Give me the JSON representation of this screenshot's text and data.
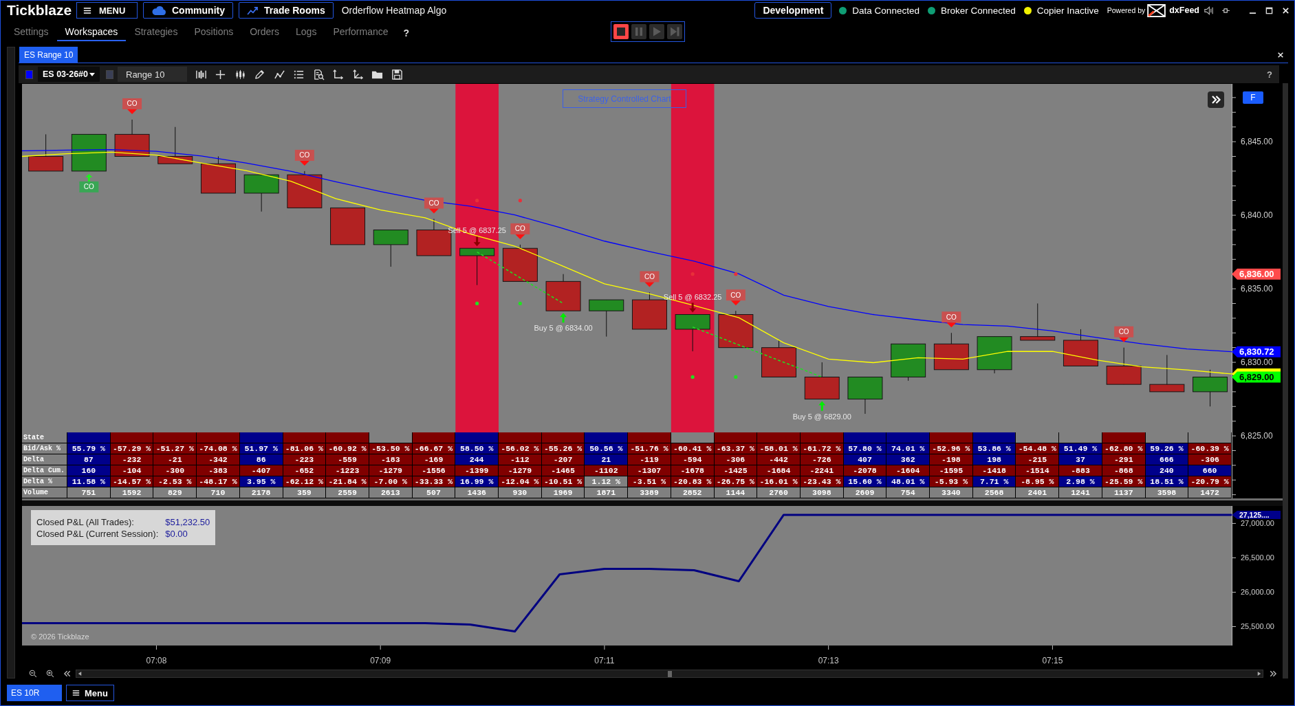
{
  "app_bar": {
    "logo": "Tickblaze",
    "menu_button": "MENU",
    "links": [
      "Community",
      "Trade Rooms"
    ],
    "title": "Orderflow Heatmap Algo",
    "environment_button": "Development",
    "statuses": [
      {
        "label": "Data Connected",
        "color": "#0f9d74"
      },
      {
        "label": "Broker Connected",
        "color": "#0f9d74"
      },
      {
        "label": "Copier Inactive",
        "color": "#f2f200"
      }
    ],
    "powered_by": "Powered by",
    "provider": "dxFeed"
  },
  "nav_tabs": [
    {
      "label": "Settings",
      "selected": false
    },
    {
      "label": "Workspaces",
      "selected": true
    },
    {
      "label": "Strategies",
      "selected": false
    },
    {
      "label": "Positions",
      "selected": false
    },
    {
      "label": "Orders",
      "selected": false
    },
    {
      "label": "Logs",
      "selected": false
    },
    {
      "label": "Performance",
      "selected": false
    }
  ],
  "help": "?",
  "playback_controls": [
    {
      "kind": "stop",
      "active": true
    },
    {
      "kind": "pause",
      "active": false
    },
    {
      "kind": "play",
      "active": false
    },
    {
      "kind": "step",
      "active": false
    }
  ],
  "document_tabs": [
    {
      "label": "ES Range 10",
      "selected": true
    }
  ],
  "chart_toolbar": {
    "instrument": {
      "label": "ES 03-26#0",
      "color": "#0000ff"
    },
    "bar_type": {
      "label": "Range 10",
      "color": "#3a3f55"
    },
    "help": "?"
  },
  "price_chart": {
    "strategy_button": "Strategy Controlled Chart",
    "scale_button": "F",
    "chart_data": {
      "type": "line",
      "categories": [
        null,
        null,
        null,
        null,
        null,
        null,
        null,
        null,
        null,
        null,
        null,
        null,
        null,
        null,
        null,
        null,
        null,
        null,
        null,
        null,
        null,
        null,
        null,
        null,
        null,
        null,
        null,
        null
      ],
      "ylim": [
        6820.75,
        6848.93
      ],
      "yticks": [
        {
          "value": 6825,
          "label": "6,825.00"
        },
        {
          "value": 6830,
          "label": "6,830.00"
        },
        {
          "value": 6835,
          "label": "6,835.00"
        },
        {
          "value": 6840,
          "label": "6,840.00"
        },
        {
          "value": 6845,
          "label": "6,845.00"
        }
      ],
      "series": [
        {
          "color": "#ffff00",
          "values": [
            6844.0,
            6844.18,
            6844.29,
            6844.09,
            6843.55,
            6843.04,
            6842.31,
            6841.13,
            6840.36,
            6839.82,
            6838.73,
            6837.9,
            6836.63,
            6835.34,
            6834.66,
            6833.86,
            6833.03,
            6831.33,
            6830.22,
            6829.98,
            6830.31,
            6830.22,
            6830.74,
            6830.74,
            6830.15,
            6829.69,
            6829.48,
            6829.21
          ]
        },
        {
          "color": "#0000ff",
          "values": [
            6844.38,
            6844.43,
            6844.46,
            6844.34,
            6844.03,
            6843.55,
            6842.99,
            6842.28,
            6841.61,
            6841.01,
            6840.62,
            6840.02,
            6839.17,
            6838.24,
            6837.53,
            6836.88,
            6836.01,
            6834.57,
            6833.79,
            6833.25,
            6832.89,
            6832.57,
            6832.46,
            6832.14,
            6831.68,
            6831.26,
            6830.91,
            6830.72
          ]
        }
      ]
    },
    "price_tags": [
      {
        "label": "6,836.00",
        "color": "#ff4b4b"
      },
      {
        "label": "6,830.72",
        "color": "#0000ff"
      },
      {
        "color": "#ffff00"
      },
      {
        "label": "6,829.00",
        "color": "#00ff00"
      }
    ],
    "bars": [
      {
        "highlighted": false
      },
      {
        "highlighted": false,
        "signal": {
          "kind": "up",
          "label": "CO"
        }
      },
      {
        "highlighted": false,
        "signal": {
          "kind": "down",
          "label": "CO"
        }
      },
      {
        "highlighted": false
      },
      {
        "highlighted": false
      },
      {
        "highlighted": false
      },
      {
        "highlighted": false,
        "signal": {
          "kind": "down",
          "label": "CO"
        }
      },
      {
        "highlighted": false
      },
      {
        "highlighted": false
      },
      {
        "highlighted": false,
        "signal": {
          "kind": "down",
          "label": "CO"
        }
      },
      {
        "highlighted": true,
        "trade": {
          "kind": "sell",
          "label": "Sell 5 @ 6837.25"
        }
      },
      {
        "highlighted": false,
        "signal": {
          "kind": "down",
          "label": "CO"
        }
      },
      {
        "highlighted": false,
        "trade": {
          "kind": "buy",
          "label": "Buy 5 @ 6834.00"
        }
      },
      {
        "highlighted": false
      },
      {
        "highlighted": false,
        "signal": {
          "kind": "down",
          "label": "CO"
        }
      },
      {
        "highlighted": true,
        "trade": {
          "kind": "sell",
          "label": "Sell 5 @ 6832.25"
        }
      },
      {
        "highlighted": false,
        "signal": {
          "kind": "down",
          "label": "CO"
        }
      },
      {
        "highlighted": false
      },
      {
        "highlighted": false,
        "trade": {
          "kind": "buy",
          "label": "Buy 5 @ 6829.00"
        }
      },
      {
        "highlighted": false
      },
      {
        "highlighted": false
      },
      {
        "highlighted": false,
        "signal": {
          "kind": "down",
          "label": "CO"
        }
      },
      {
        "highlighted": false
      },
      {
        "highlighted": false
      },
      {
        "highlighted": false
      },
      {
        "highlighted": false,
        "signal": {
          "kind": "down",
          "label": "CO"
        }
      },
      {
        "highlighted": false
      },
      {
        "highlighted": false
      }
    ]
  },
  "data_table": {
    "rows": [
      {
        "label": "State",
        "cells": [
          {
            "color": "#00008b"
          },
          {
            "color": "#800000"
          },
          {
            "color": "#800000"
          },
          {
            "color": "#800000"
          },
          {
            "color": "#00008b"
          },
          {
            "color": "#800000"
          },
          {
            "color": "#800000"
          },
          {
            "color": "#808080"
          },
          {
            "color": "#800000"
          },
          {
            "color": "#00008b"
          },
          {
            "color": "#800000"
          },
          {
            "color": "#800000"
          },
          {
            "color": "#00008b"
          },
          {
            "color": "#800000"
          },
          {
            "color": "#808080"
          },
          {
            "color": "#800000"
          },
          {
            "color": "#800000"
          },
          {
            "color": "#800000"
          },
          {
            "color": "#00008b"
          },
          {
            "color": "#00008b"
          },
          {
            "color": "#800000"
          },
          {
            "color": "#00008b"
          },
          {
            "color": "#808080"
          },
          {
            "color": "#808080"
          },
          {
            "color": "#800000"
          },
          {
            "color": "#808080"
          },
          {
            "color": "#808080"
          }
        ]
      },
      {
        "label": "Bid/Ask %",
        "cells": [
          {
            "text": "55.79 %",
            "color": "#00008b"
          },
          {
            "text": "-57.29 %",
            "color": "#800000"
          },
          {
            "text": "-51.27 %",
            "color": "#800000"
          },
          {
            "text": "-74.08 %",
            "color": "#800000"
          },
          {
            "text": "51.97 %",
            "color": "#00008b"
          },
          {
            "text": "-81.06 %",
            "color": "#800000"
          },
          {
            "text": "-60.92 %",
            "color": "#800000"
          },
          {
            "text": "-53.50 %",
            "color": "#800000"
          },
          {
            "text": "-66.67 %",
            "color": "#800000"
          },
          {
            "text": "58.50 %",
            "color": "#00008b"
          },
          {
            "text": "-56.02 %",
            "color": "#800000"
          },
          {
            "text": "-55.26 %",
            "color": "#800000"
          },
          {
            "text": "50.56 %",
            "color": "#00008b"
          },
          {
            "text": "-51.76 %",
            "color": "#800000"
          },
          {
            "text": "-60.41 %",
            "color": "#800000"
          },
          {
            "text": "-63.37 %",
            "color": "#800000"
          },
          {
            "text": "-58.01 %",
            "color": "#800000"
          },
          {
            "text": "-61.72 %",
            "color": "#800000"
          },
          {
            "text": "57.80 %",
            "color": "#00008b"
          },
          {
            "text": "74.01 %",
            "color": "#00008b"
          },
          {
            "text": "-52.96 %",
            "color": "#800000"
          },
          {
            "text": "53.86 %",
            "color": "#00008b"
          },
          {
            "text": "-54.48 %",
            "color": "#800000"
          },
          {
            "text": "51.49 %",
            "color": "#00008b"
          },
          {
            "text": "-62.80 %",
            "color": "#800000"
          },
          {
            "text": "59.26 %",
            "color": "#00008b"
          },
          {
            "text": "-60.39 %",
            "color": "#800000"
          }
        ]
      },
      {
        "label": "Delta",
        "cells": [
          {
            "text": "87",
            "color": "#00008b"
          },
          {
            "text": "-232",
            "color": "#800000"
          },
          {
            "text": "-21",
            "color": "#800000"
          },
          {
            "text": "-342",
            "color": "#800000"
          },
          {
            "text": "86",
            "color": "#00008b"
          },
          {
            "text": "-223",
            "color": "#800000"
          },
          {
            "text": "-559",
            "color": "#800000"
          },
          {
            "text": "-183",
            "color": "#800000"
          },
          {
            "text": "-169",
            "color": "#800000"
          },
          {
            "text": "244",
            "color": "#00008b"
          },
          {
            "text": "-112",
            "color": "#800000"
          },
          {
            "text": "-207",
            "color": "#800000"
          },
          {
            "text": "21",
            "color": "#00008b"
          },
          {
            "text": "-119",
            "color": "#800000"
          },
          {
            "text": "-594",
            "color": "#800000"
          },
          {
            "text": "-306",
            "color": "#800000"
          },
          {
            "text": "-442",
            "color": "#800000"
          },
          {
            "text": "-726",
            "color": "#800000"
          },
          {
            "text": "407",
            "color": "#00008b"
          },
          {
            "text": "362",
            "color": "#00008b"
          },
          {
            "text": "-198",
            "color": "#800000"
          },
          {
            "text": "198",
            "color": "#00008b"
          },
          {
            "text": "-215",
            "color": "#800000"
          },
          {
            "text": "37",
            "color": "#00008b"
          },
          {
            "text": "-291",
            "color": "#800000"
          },
          {
            "text": "666",
            "color": "#00008b"
          },
          {
            "text": "-306",
            "color": "#800000"
          }
        ]
      },
      {
        "label": "Delta Cum.",
        "cells": [
          {
            "text": "160",
            "color": "#00008b"
          },
          {
            "text": "-104",
            "color": "#800000"
          },
          {
            "text": "-300",
            "color": "#800000"
          },
          {
            "text": "-383",
            "color": "#800000"
          },
          {
            "text": "-407",
            "color": "#800000"
          },
          {
            "text": "-652",
            "color": "#800000"
          },
          {
            "text": "-1223",
            "color": "#800000"
          },
          {
            "text": "-1279",
            "color": "#800000"
          },
          {
            "text": "-1556",
            "color": "#800000"
          },
          {
            "text": "-1399",
            "color": "#800000"
          },
          {
            "text": "-1279",
            "color": "#800000"
          },
          {
            "text": "-1465",
            "color": "#800000"
          },
          {
            "text": "-1102",
            "color": "#800000"
          },
          {
            "text": "-1307",
            "color": "#800000"
          },
          {
            "text": "-1678",
            "color": "#800000"
          },
          {
            "text": "-1425",
            "color": "#800000"
          },
          {
            "text": "-1684",
            "color": "#800000"
          },
          {
            "text": "-2241",
            "color": "#800000"
          },
          {
            "text": "-2078",
            "color": "#800000"
          },
          {
            "text": "-1604",
            "color": "#800000"
          },
          {
            "text": "-1595",
            "color": "#800000"
          },
          {
            "text": "-1418",
            "color": "#800000"
          },
          {
            "text": "-1514",
            "color": "#800000"
          },
          {
            "text": "-883",
            "color": "#800000"
          },
          {
            "text": "-868",
            "color": "#800000"
          },
          {
            "text": "240",
            "color": "#00008b"
          },
          {
            "text": "660",
            "color": "#00008b"
          }
        ]
      },
      {
        "label": "Delta %",
        "cells": [
          {
            "text": "11.58 %",
            "color": "#00008b"
          },
          {
            "text": "-14.57 %",
            "color": "#800000"
          },
          {
            "text": "-2.53 %",
            "color": "#800000"
          },
          {
            "text": "-48.17 %",
            "color": "#800000"
          },
          {
            "text": "3.95 %",
            "color": "#00008b"
          },
          {
            "text": "-62.12 %",
            "color": "#800000"
          },
          {
            "text": "-21.84 %",
            "color": "#800000"
          },
          {
            "text": "-7.00 %",
            "color": "#800000"
          },
          {
            "text": "-33.33 %",
            "color": "#800000"
          },
          {
            "text": "16.99 %",
            "color": "#00008b"
          },
          {
            "text": "-12.04 %",
            "color": "#800000"
          },
          {
            "text": "-10.51 %",
            "color": "#800000"
          },
          {
            "text": "1.12 %",
            "color": "#808080"
          },
          {
            "text": "-3.51 %",
            "color": "#800000"
          },
          {
            "text": "-20.83 %",
            "color": "#800000"
          },
          {
            "text": "-26.75 %",
            "color": "#800000"
          },
          {
            "text": "-16.01 %",
            "color": "#800000"
          },
          {
            "text": "-23.43 %",
            "color": "#800000"
          },
          {
            "text": "15.60 %",
            "color": "#00008b"
          },
          {
            "text": "48.01 %",
            "color": "#00008b"
          },
          {
            "text": "-5.93 %",
            "color": "#800000"
          },
          {
            "text": "7.71 %",
            "color": "#00008b"
          },
          {
            "text": "-8.95 %",
            "color": "#800000"
          },
          {
            "text": "2.98 %",
            "color": "#00008b"
          },
          {
            "text": "-25.59 %",
            "color": "#800000"
          },
          {
            "text": "18.51 %",
            "color": "#00008b"
          },
          {
            "text": "-20.79 %",
            "color": "#800000"
          }
        ]
      },
      {
        "label": "Volume",
        "cells": [
          {
            "text": "751",
            "color": "#808080"
          },
          {
            "text": "1592",
            "color": "#808080"
          },
          {
            "text": "829",
            "color": "#808080"
          },
          {
            "text": "710",
            "color": "#808080"
          },
          {
            "text": "2178",
            "color": "#808080"
          },
          {
            "text": "359",
            "color": "#808080"
          },
          {
            "text": "2559",
            "color": "#808080"
          },
          {
            "text": "2613",
            "color": "#808080"
          },
          {
            "text": "507",
            "color": "#808080"
          },
          {
            "text": "1436",
            "color": "#808080"
          },
          {
            "text": "930",
            "color": "#808080"
          },
          {
            "text": "1969",
            "color": "#808080"
          },
          {
            "text": "1871",
            "color": "#808080"
          },
          {
            "text": "3389",
            "color": "#808080"
          },
          {
            "text": "2852",
            "color": "#808080"
          },
          {
            "text": "1144",
            "color": "#808080"
          },
          {
            "text": "2760",
            "color": "#808080"
          },
          {
            "text": "3098",
            "color": "#808080"
          },
          {
            "text": "2609",
            "color": "#808080"
          },
          {
            "text": "754",
            "color": "#808080"
          },
          {
            "text": "3340",
            "color": "#808080"
          },
          {
            "text": "2568",
            "color": "#808080"
          },
          {
            "text": "2401",
            "color": "#808080"
          },
          {
            "text": "1241",
            "color": "#808080"
          },
          {
            "text": "1137",
            "color": "#808080"
          },
          {
            "text": "3598",
            "color": "#808080"
          },
          {
            "text": "1472",
            "color": "#808080"
          }
        ]
      }
    ]
  },
  "pnl_chart": {
    "summary": [
      {
        "label": "Closed P&L (All Trades):",
        "value": "$51,232.50"
      },
      {
        "label": "Closed P&L (Current Session):",
        "value": "$0.00"
      }
    ],
    "copyright": "© 2026 Tickblaze",
    "chart_data": {
      "type": "line",
      "categories": [
        null,
        null,
        null,
        "07:08",
        null,
        null,
        null,
        null,
        "07:09",
        null,
        null,
        null,
        null,
        "07:11",
        null,
        null,
        null,
        null,
        "07:13",
        null,
        null,
        null,
        null,
        "07:15",
        null,
        null,
        null,
        null
      ],
      "ylim": [
        25225,
        27254
      ],
      "yticks": [
        {
          "value": 25500,
          "label": "25,500.00"
        },
        {
          "value": 26000,
          "label": "26,000.00"
        },
        {
          "value": 26500,
          "label": "26,500.00"
        },
        {
          "value": 27000,
          "label": "27,000.00"
        }
      ],
      "series": [
        {
          "color": "#000080",
          "values": [
            25550,
            25550,
            25550,
            25550,
            25550,
            25550,
            25550,
            25550,
            25550,
            25550,
            25530,
            25430,
            26260,
            26340,
            26340,
            26320,
            26160,
            27125,
            27125,
            27125,
            27125,
            27125,
            27125,
            27125,
            27125,
            27125,
            27125,
            27125
          ]
        }
      ]
    },
    "last_value_tag": {
      "label": "27,125....",
      "color": "#00008b"
    }
  },
  "bottom_bar": {
    "tabs": [
      {
        "label": "ES 10R",
        "selected": true
      }
    ],
    "menu_button": "Menu"
  }
}
